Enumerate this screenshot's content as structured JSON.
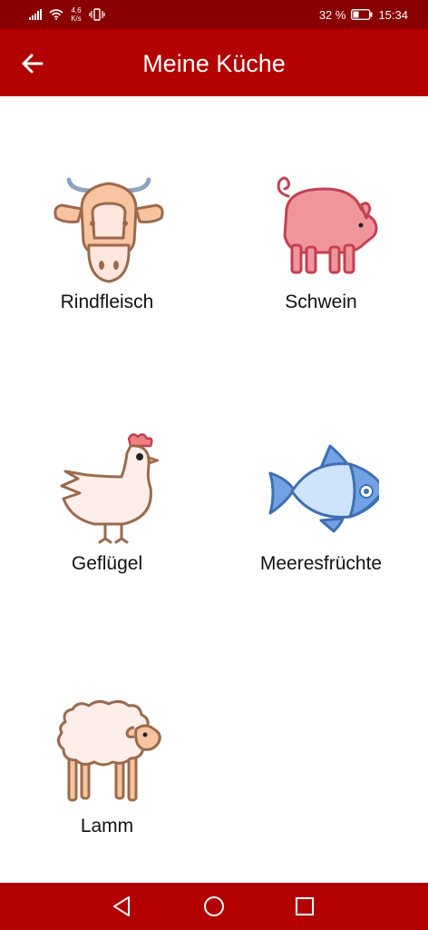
{
  "status_bar": {
    "net_speed_value": "4,6",
    "net_speed_unit": "K/s",
    "battery_percent": "32 %",
    "time": "15:34"
  },
  "app_bar": {
    "title": "Meine Küche",
    "back_icon": "arrow-left-icon"
  },
  "categories": [
    {
      "label": "Rindfleisch",
      "icon": "cow-icon"
    },
    {
      "label": "Schwein",
      "icon": "pig-icon"
    },
    {
      "label": "Geflügel",
      "icon": "chicken-icon"
    },
    {
      "label": "Meeresfrüchte",
      "icon": "fish-icon"
    },
    {
      "label": "Lamm",
      "icon": "sheep-icon"
    }
  ],
  "nav_bar": {
    "icons": [
      "back-triangle-icon",
      "home-circle-icon",
      "recents-square-icon"
    ]
  },
  "colors": {
    "status_bar": "#8a0000",
    "app_bar": "#b30000",
    "nav_bar": "#b30000"
  }
}
